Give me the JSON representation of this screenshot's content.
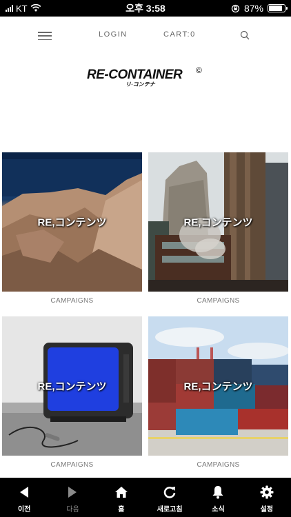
{
  "status_bar": {
    "carrier": "KT",
    "time": "오후 3:58",
    "battery": "87%",
    "battery_level": 0.87
  },
  "nav": {
    "login": "LOGIN",
    "cart": "CART:0"
  },
  "logo": {
    "main": "RE-CONTAINER",
    "mark": "©",
    "sub": "リ·コンテナ"
  },
  "cards": [
    {
      "overlay": "RE,コンテンツ",
      "caption": "CAMPAIGNS"
    },
    {
      "overlay": "RE,コンテンツ",
      "caption": "CAMPAIGNS"
    },
    {
      "overlay": "RE,コンテンツ",
      "caption": "CAMPAIGNS"
    },
    {
      "overlay": "RE,コンテンツ",
      "caption": "CAMPAIGNS"
    }
  ],
  "toolbar": {
    "back": "이전",
    "forward": "다음",
    "home": "홈",
    "refresh": "새로고침",
    "news": "소식",
    "settings": "설정"
  }
}
